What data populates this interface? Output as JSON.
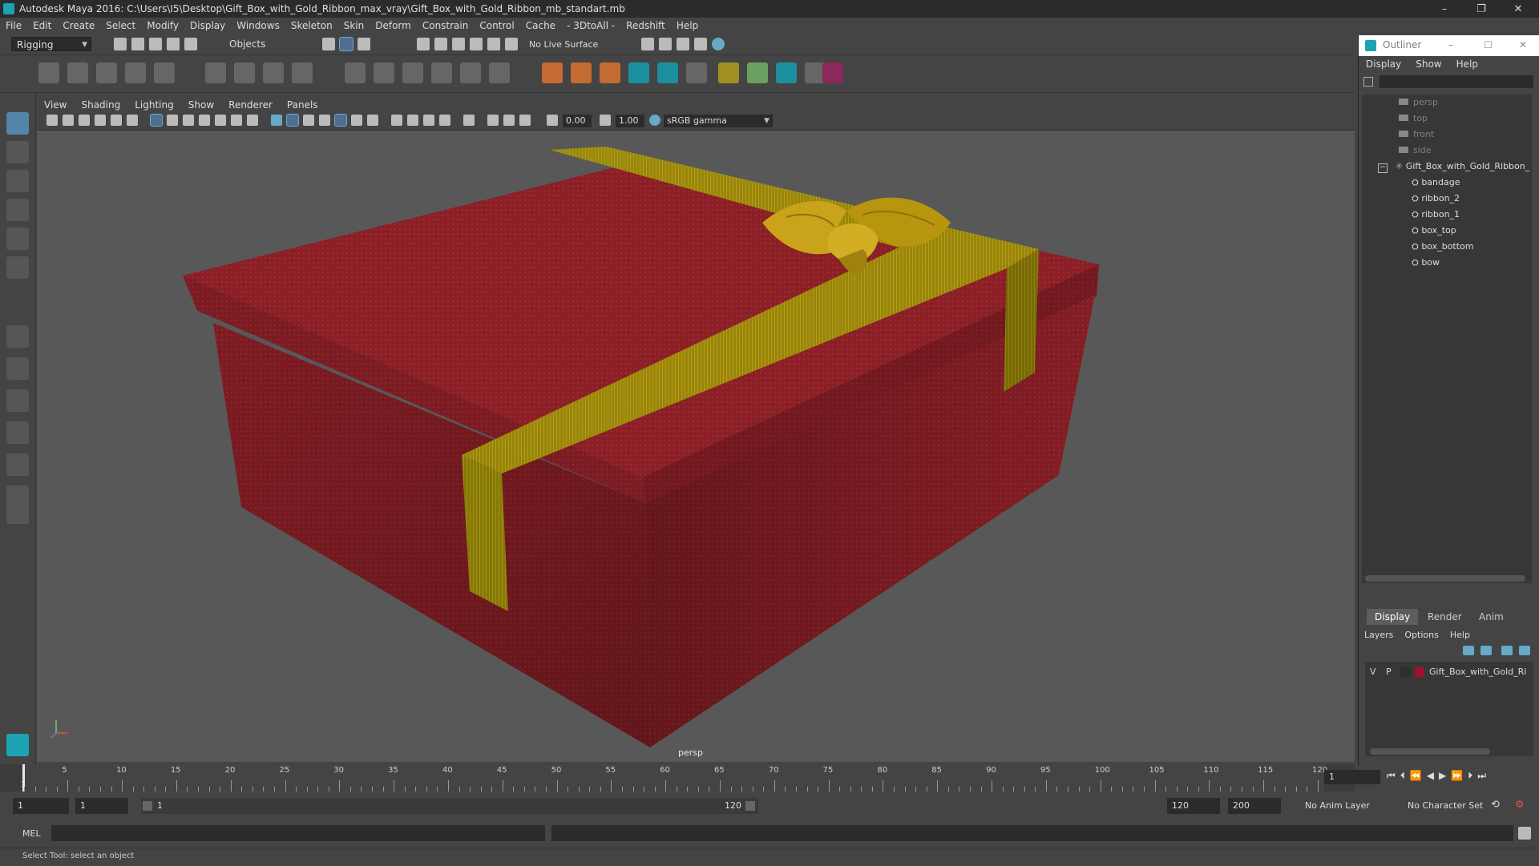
{
  "window": {
    "title": "Autodesk Maya 2016: C:\\Users\\I5\\Desktop\\Gift_Box_with_Gold_Ribbon_max_vray\\Gift_Box_with_Gold_Ribbon_mb_standart.mb",
    "minimize": "–",
    "restore": "❐",
    "close": "✕"
  },
  "menubar": [
    "File",
    "Edit",
    "Create",
    "Select",
    "Modify",
    "Display",
    "Windows",
    "Skeleton",
    "Skin",
    "Deform",
    "Constrain",
    "Control",
    "Cache",
    "- 3DtoAll -",
    "Redshift",
    "Help"
  ],
  "statusline": {
    "menuset": "Rigging",
    "selection_mode": "Objects",
    "live_surface": "No Live Surface"
  },
  "viewport": {
    "menu": [
      "View",
      "Shading",
      "Lighting",
      "Show",
      "Renderer",
      "Panels"
    ],
    "near_value": "0.00",
    "far_value": "1.00",
    "color_space": "sRGB gamma",
    "camera_label": "persp"
  },
  "outliner": {
    "title": "Outliner",
    "menu": [
      "Display",
      "Show",
      "Help"
    ],
    "cameras": [
      "persp",
      "top",
      "front",
      "side"
    ],
    "group": "Gift_Box_with_Gold_Ribbon_",
    "children": [
      "bandage",
      "ribbon_2",
      "ribbon_1",
      "box_top",
      "box_bottom",
      "bow"
    ],
    "minimize": "–",
    "maximize": "☐",
    "close": "✕"
  },
  "layer_editor": {
    "tabs": [
      "Display",
      "Render",
      "Anim"
    ],
    "menu": [
      "Layers",
      "Options",
      "Help"
    ],
    "layer": {
      "v": "V",
      "p": "P",
      "name": "Gift_Box_with_Gold_Ri",
      "color": "#a0112f"
    }
  },
  "timeline": {
    "ticks": [
      5,
      10,
      15,
      20,
      25,
      30,
      35,
      40,
      45,
      50,
      55,
      60,
      65,
      70,
      75,
      80,
      85,
      90,
      95,
      100,
      105,
      110,
      115,
      120
    ],
    "start_label": "1",
    "current_frame": "1"
  },
  "range": {
    "start": "1",
    "playback_start": "1",
    "slider_start": "1",
    "slider_end": "120",
    "playback_end": "120",
    "end": "200",
    "anim_layer": "No Anim Layer",
    "character_set": "No Character Set"
  },
  "commandline": {
    "label": "MEL"
  },
  "helpline": {
    "text": "Select Tool: select an object"
  },
  "colors": {
    "box_red": "#8a1f26",
    "ribbon_gold": "#9a8a0a",
    "bow_gold": "#c9a41a",
    "viewport_bg": "#585858"
  }
}
